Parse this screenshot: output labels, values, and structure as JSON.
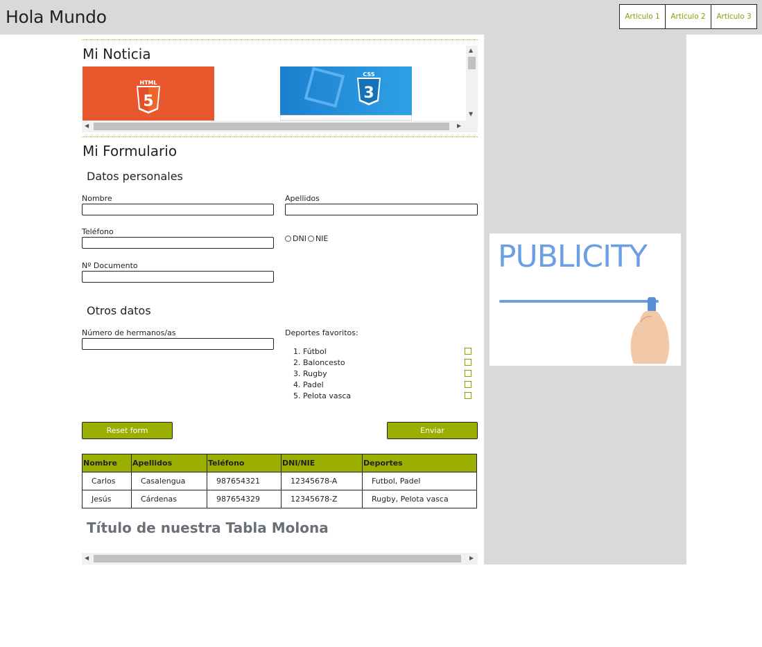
{
  "header": {
    "title": "Hola Mundo"
  },
  "nav": {
    "items": [
      "Articulo 1",
      "Articulo 2",
      "Articulo 3"
    ]
  },
  "news": {
    "title": "Mi Noticia",
    "images": [
      {
        "alt": "HTML5",
        "label": "HTML"
      },
      {
        "alt": "CSS3",
        "label": "CSS"
      }
    ]
  },
  "form": {
    "title": "Mi Formulario",
    "personal_legend": "Datos personales",
    "nombre_label": "Nombre",
    "apellidos_label": "Apellidos",
    "telefono_label": "Teléfono",
    "documento_label": "Nº Documento",
    "doc_options": [
      "DNI",
      "NIE"
    ],
    "other_legend": "Otros datos",
    "hermanos_label": "Número de hermanos/as",
    "sports_label": "Deportes favoritos:",
    "sports": [
      "1. Fútbol",
      "2. Baloncesto",
      "3. Rugby",
      "4. Padel",
      "5. Pelota vasca"
    ],
    "reset_label": "Reset form",
    "submit_label": "Enviar"
  },
  "table": {
    "headers": [
      "Nombre",
      "Apellidos",
      "Teléfono",
      "DNI/NIE",
      "Deportes"
    ],
    "rows": [
      [
        "Carlos",
        "Casalengua",
        "987654321",
        "12345678-A",
        "Futbol, Padel"
      ],
      [
        "Jesús",
        "Cárdenas",
        "987654329",
        "12345678-Z",
        "Rugby, Pelota vasca"
      ]
    ],
    "caption": "Título de nuestra Tabla Molona"
  },
  "aside": {
    "ad_text": "PUBLICITY"
  },
  "colors": {
    "accent": "#9aaf00",
    "nav_text": "#8aa000",
    "header_bg": "#d9d9d9",
    "ad_blue": "#6a9fe3"
  }
}
